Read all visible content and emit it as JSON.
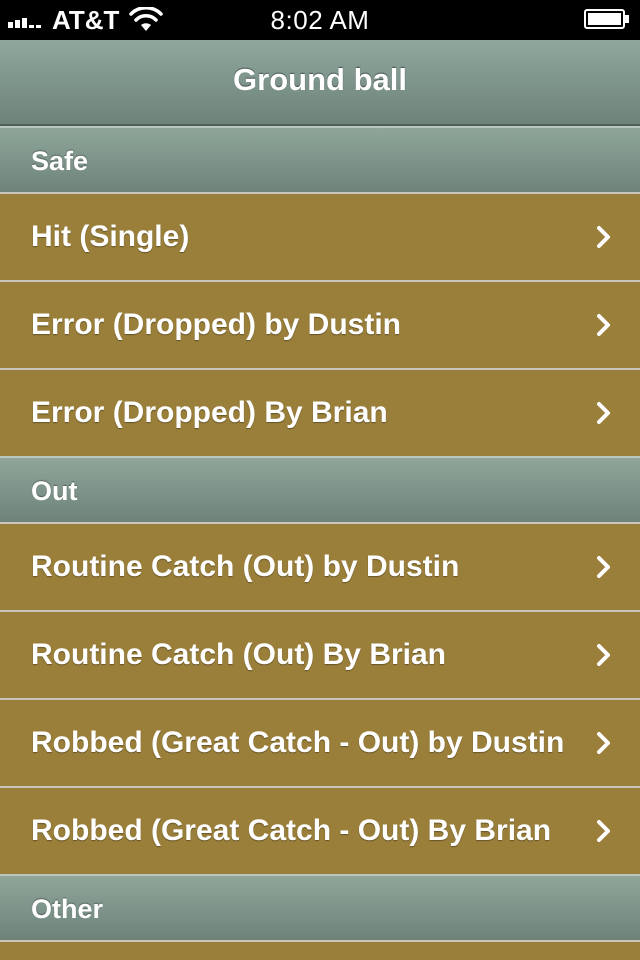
{
  "status_bar": {
    "carrier": "AT&T",
    "time": "8:02 AM"
  },
  "nav": {
    "title": "Ground ball"
  },
  "sections": [
    {
      "label": "Safe",
      "rows": [
        {
          "label": "Hit (Single)"
        },
        {
          "label": "Error (Dropped) by Dustin"
        },
        {
          "label": "Error (Dropped) By Brian"
        }
      ]
    },
    {
      "label": "Out",
      "rows": [
        {
          "label": "Routine Catch (Out) by Dustin"
        },
        {
          "label": "Routine Catch (Out) By Brian"
        },
        {
          "label": "Robbed (Great Catch - Out) by Dustin"
        },
        {
          "label": "Robbed (Great Catch - Out) By Brian"
        }
      ]
    },
    {
      "label": "Other",
      "rows": []
    }
  ],
  "icons": {
    "row_accessory": "chevron-right-icon"
  },
  "colors": {
    "row_background": "#9a7f3a",
    "header_background": "#7e958c",
    "text": "#ffffff"
  }
}
